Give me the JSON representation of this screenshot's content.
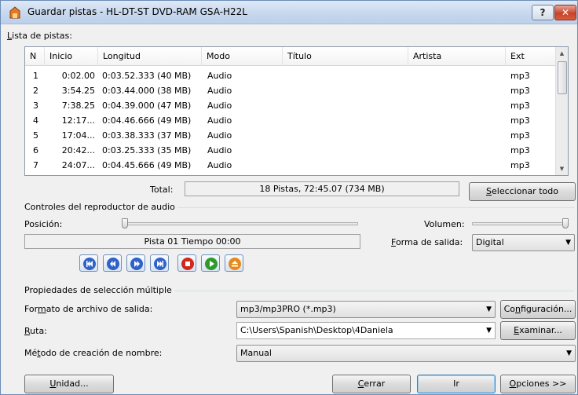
{
  "window": {
    "title": "Guardar pistas - HL-DT-ST DVD-RAM GSA-H22L",
    "help_label": "?",
    "close_label": "✕"
  },
  "track_list": {
    "label_prefix": "",
    "label_underline": "L",
    "label_rest": "ista de pistas:",
    "columns": [
      "N",
      "Inicio",
      "Longitud",
      "Modo",
      "Título",
      "Artista",
      "Ext"
    ],
    "rows": [
      {
        "n": "1",
        "start": "0:02.00",
        "length": "0:03.52.333 (40 MB)",
        "mode": "Audio",
        "title": "",
        "artist": "",
        "ext": "mp3"
      },
      {
        "n": "2",
        "start": "3:54.25",
        "length": "0:03.44.000 (38 MB)",
        "mode": "Audio",
        "title": "",
        "artist": "",
        "ext": "mp3"
      },
      {
        "n": "3",
        "start": "7:38.25",
        "length": "0:04.39.000 (47 MB)",
        "mode": "Audio",
        "title": "",
        "artist": "",
        "ext": "mp3"
      },
      {
        "n": "4",
        "start": "12:17...",
        "length": "0:04.46.666 (49 MB)",
        "mode": "Audio",
        "title": "",
        "artist": "",
        "ext": "mp3"
      },
      {
        "n": "5",
        "start": "17:04...",
        "length": "0:03.38.333 (37 MB)",
        "mode": "Audio",
        "title": "",
        "artist": "",
        "ext": "mp3"
      },
      {
        "n": "6",
        "start": "20:42...",
        "length": "0:03.25.333 (35 MB)",
        "mode": "Audio",
        "title": "",
        "artist": "",
        "ext": "mp3"
      },
      {
        "n": "7",
        "start": "24:07...",
        "length": "0:04.45.666 (49 MB)",
        "mode": "Audio",
        "title": "",
        "artist": "",
        "ext": "mp3"
      }
    ]
  },
  "total": {
    "label": "Total:",
    "value": "18 Pistas,  72:45.07 (734 MB)"
  },
  "select_all": {
    "underline": "S",
    "rest": "eleccionar todo"
  },
  "player": {
    "group_title": "Controles del reproductor de audio",
    "position_label": "Posición:",
    "volume_label": "Volumen:",
    "status_text": "Pista 01 Tiempo 00:00",
    "output_label_underline": "F",
    "output_label_rest": "orma de salida:",
    "output_value": "Digital",
    "buttons": [
      "skip-back-icon",
      "rewind-icon",
      "fast-forward-icon",
      "skip-forward-icon",
      "stop-icon",
      "play-icon",
      "eject-icon"
    ]
  },
  "multi": {
    "group_title": "Propiedades de selección múltiple",
    "format_label_pre": "For",
    "format_label_ul": "m",
    "format_label_post": "ato de archivo de salida:",
    "format_value": "mp3/mp3PRO (*.mp3)",
    "config_pre": "Co",
    "config_ul": "n",
    "config_post": "figuración...",
    "path_label_ul": "R",
    "path_label_rest": "uta:",
    "path_value": "C:\\Users\\Spanish\\Desktop\\4Daniela",
    "browse_ul": "E",
    "browse_rest": "xaminar...",
    "naming_label_pre": "Mé",
    "naming_label_ul": "t",
    "naming_label_post": "odo de creación de nombre:",
    "naming_value": "Manual"
  },
  "footer": {
    "unit_ul": "U",
    "unit_rest": "nidad...",
    "close_ul": "C",
    "close_rest": "errar",
    "go_label": "Ir",
    "options_ul": "O",
    "options_rest": "pciones >>"
  }
}
